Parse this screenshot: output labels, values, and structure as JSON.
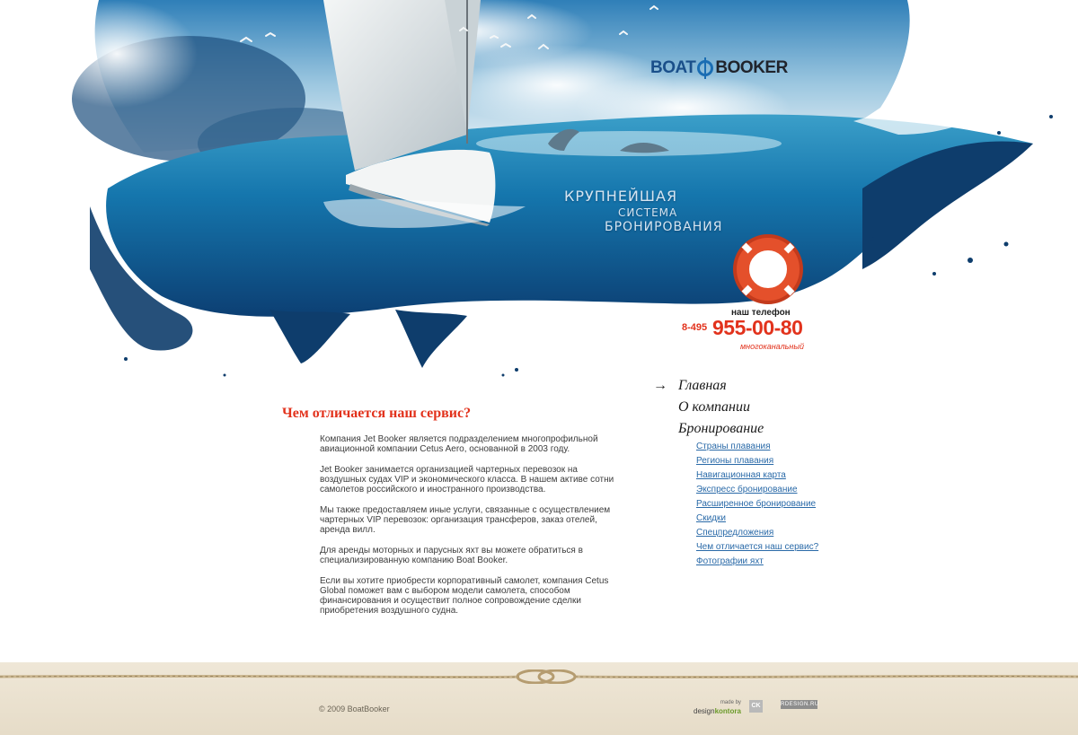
{
  "brand": {
    "logo_part1": "BOAT",
    "logo_part2": "BOOKER"
  },
  "slogan": {
    "line1": "КРУПНЕЙШАЯ",
    "line2": "СИСТЕМА",
    "line3": "БРОНИРОВАНИЯ"
  },
  "phone": {
    "label": "наш телефон",
    "prefix": "8-495",
    "number": "955-00-80",
    "note": "многоканальный"
  },
  "section": {
    "title": "Чем отличается наш сервис?",
    "paragraphs": [
      "Компания Jet Booker является подразделением многопрофильной авиационной компании Cetus Aero, основанной в 2003 году.",
      "Jet Booker занимается организацией чартерных перевозок на воздушных судах VIP и экономического класса. В нашем активе сотни самолетов российского и иностранного производства.",
      "Мы также предоставляем иные услуги, связанные с осуществлением чартерных VIP перевозок: организация трансферов, заказ отелей, аренда вилл.",
      "Для аренды моторных и парусных яхт вы можете обратиться в специализированную компанию Boat Booker.",
      "Если вы хотите приобрести корпоративный самолет, компания Cetus Global поможет вам с выбором модели самолета, способом финансирования и осуществит полное сопровождение сделки приобретения воздушного судна."
    ]
  },
  "nav": {
    "active_marker": "→",
    "main": [
      "Главная",
      "О компании",
      "Бронирование"
    ],
    "sub": [
      "Страны плавания",
      "Регионы плавания",
      "Навигационная карта",
      "Экспресс бронирование",
      "Расширенное бронирование",
      "Скидки",
      "Спецпредложения",
      "Чем отличается наш сервис?",
      "Фотографии яхт"
    ]
  },
  "footer": {
    "copyright": "© 2009 BoatBooker",
    "made_by": "made by",
    "design_a": "design",
    "design_b": "kontora",
    "ck": "CK",
    "rdesign": "RDESIGN.RU"
  },
  "colors": {
    "accent": "#e2321c",
    "link": "#2a6aa8",
    "sea": "#1a6db3",
    "footer_bg": "#ebe2d0"
  },
  "icons": [
    "sailboat",
    "dolphin-icon",
    "life-ring-icon",
    "seagull-icon",
    "rope-knot-icon",
    "arrow-right-icon"
  ]
}
